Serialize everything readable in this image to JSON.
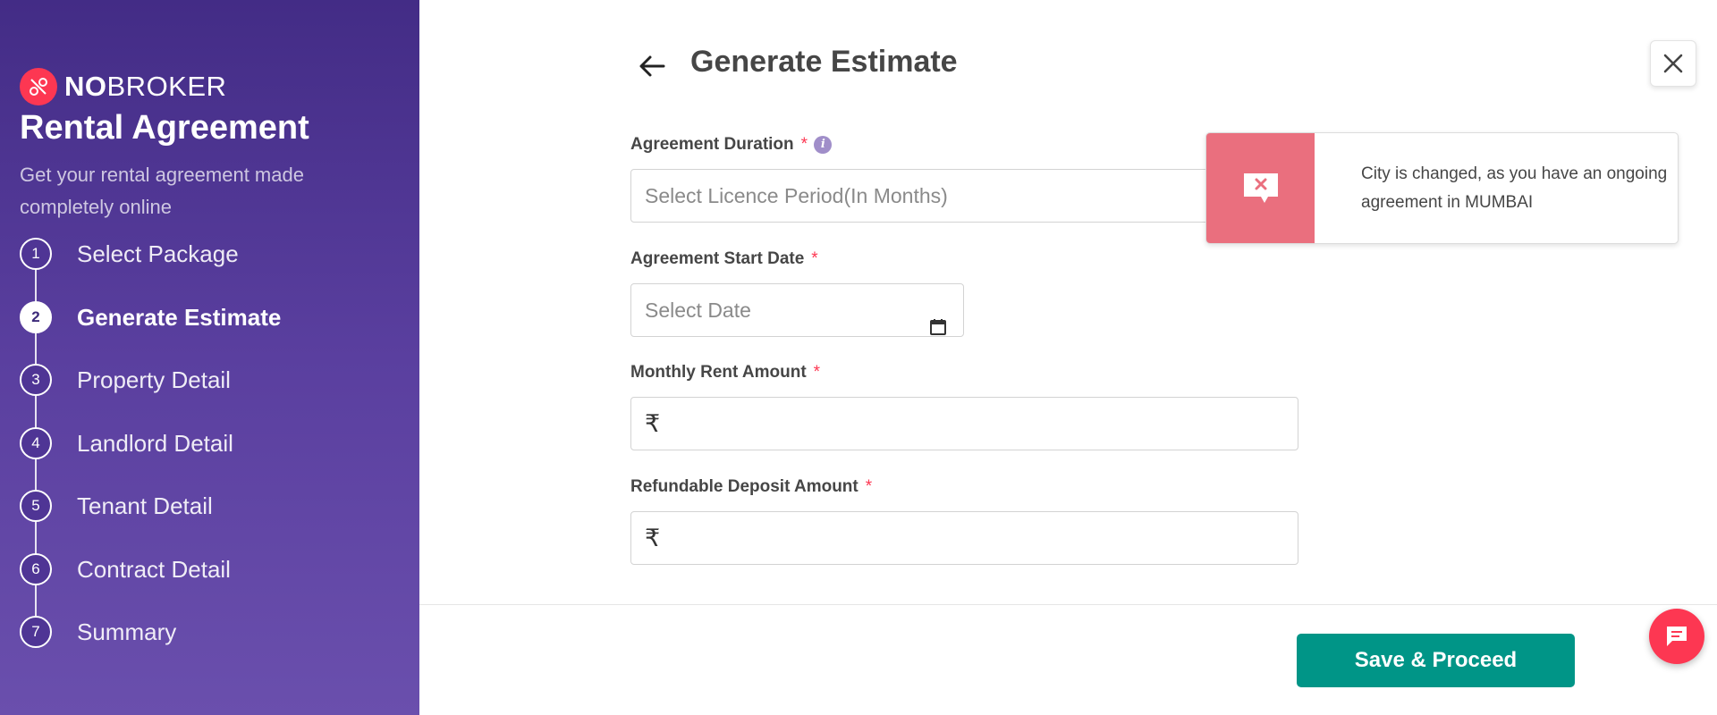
{
  "brand": {
    "name_bold": "NO",
    "name_light": "BROKER"
  },
  "sidebar": {
    "title": "Rental Agreement",
    "subtitle": "Get your rental agreement made completely online",
    "steps": [
      {
        "number": "1",
        "label": "Select Package",
        "active": false
      },
      {
        "number": "2",
        "label": "Generate Estimate",
        "active": true
      },
      {
        "number": "3",
        "label": "Property Detail",
        "active": false
      },
      {
        "number": "4",
        "label": "Landlord Detail",
        "active": false
      },
      {
        "number": "5",
        "label": "Tenant Detail",
        "active": false
      },
      {
        "number": "6",
        "label": "Contract Detail",
        "active": false
      },
      {
        "number": "7",
        "label": "Summary",
        "active": false
      }
    ]
  },
  "header": {
    "title": "Generate Estimate"
  },
  "form": {
    "duration": {
      "label": "Agreement Duration",
      "required_mark": "*",
      "placeholder": "Select Licence Period(In Months)"
    },
    "start_date": {
      "label": "Agreement Start Date",
      "required_mark": "*",
      "placeholder": "Select Date"
    },
    "rent": {
      "label": "Monthly Rent Amount",
      "required_mark": "*",
      "currency_symbol": "₹",
      "value": ""
    },
    "deposit": {
      "label": "Refundable Deposit Amount",
      "required_mark": "*",
      "currency_symbol": "₹",
      "value": ""
    }
  },
  "footer": {
    "save_label": "Save & Proceed"
  },
  "toast": {
    "message": "City is changed, as you have an ongoing agreement in MUMBAI"
  },
  "icons": {
    "back": "arrow-left-icon",
    "close": "close-icon",
    "info": "info-icon",
    "calendar": "calendar-icon",
    "chat": "chat-icon",
    "toast": "error-message-icon",
    "logo": "nobroker-logo-icon"
  },
  "colors": {
    "sidebar_top": "#432c86",
    "sidebar_bottom": "#6a4fad",
    "brand_red": "#fd3752",
    "primary_green": "#009587",
    "toast_side": "#ea6f7e"
  }
}
